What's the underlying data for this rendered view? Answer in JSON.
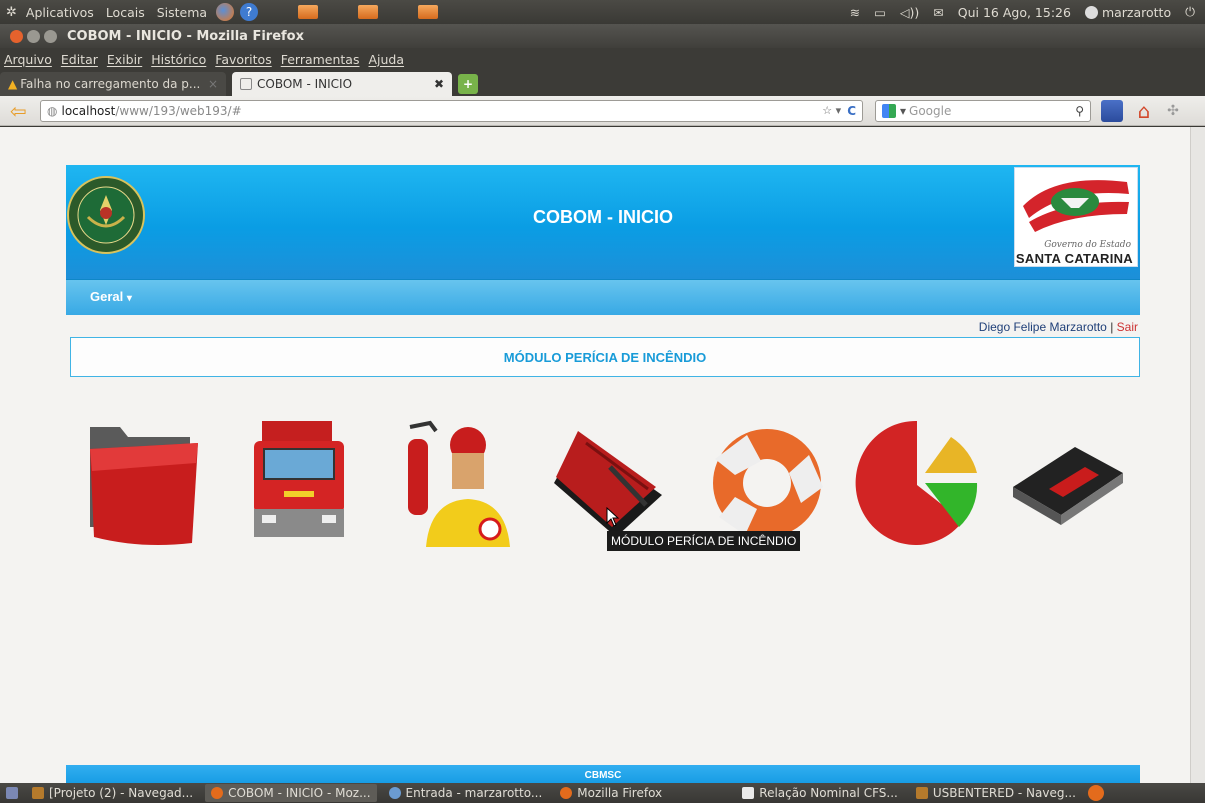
{
  "top_panel": {
    "menus": [
      "Aplicativos",
      "Locais",
      "Sistema"
    ],
    "datetime": "Qui 16 Ago, 15:26",
    "username": "marzarotto"
  },
  "window": {
    "title": "COBOM - INICIO - Mozilla Firefox"
  },
  "menubar": [
    "Arquivo",
    "Editar",
    "Exibir",
    "Histórico",
    "Favoritos",
    "Ferramentas",
    "Ajuda"
  ],
  "tabs": [
    {
      "label": "Falha no carregamento da p...",
      "active": false
    },
    {
      "label": "COBOM - INICIO",
      "active": true
    }
  ],
  "navbar": {
    "url_host": "localhost",
    "url_path": "/www/193/web193/#",
    "search_placeholder": "Google"
  },
  "page": {
    "header_title": "COBOM - INICIO",
    "logo_gov": "Governo do Estado",
    "logo_state": "SANTA CATARINA",
    "menu_geral": "Geral",
    "user_name": "Diego Felipe Marzarotto",
    "separator": "|",
    "logout": "Sair",
    "module_title": "MÓDULO PERÍCIA DE INCÊNDIO",
    "tooltip": "MÓDULO PERÍCIA DE INCÊNDIO",
    "footer": "CBMSC",
    "modules": [
      {
        "icon": "folder-icon"
      },
      {
        "icon": "fire-truck-icon"
      },
      {
        "icon": "firefighter-extinguisher-icon"
      },
      {
        "icon": "notebook-icon"
      },
      {
        "icon": "lifebuoy-icon"
      },
      {
        "icon": "pie-chart-icon"
      },
      {
        "icon": "card-reader-icon"
      }
    ]
  },
  "taskbar": [
    {
      "label": "[Projeto (2) - Navegad...",
      "active": false
    },
    {
      "label": "COBOM - INICIO - Moz...",
      "active": true
    },
    {
      "label": "Entrada - marzarotto...",
      "active": false
    },
    {
      "label": "Mozilla Firefox",
      "active": false
    },
    {
      "label": "Relação Nominal CFS...",
      "active": false
    },
    {
      "label": "USBENTERED - Naveg...",
      "active": false
    }
  ]
}
